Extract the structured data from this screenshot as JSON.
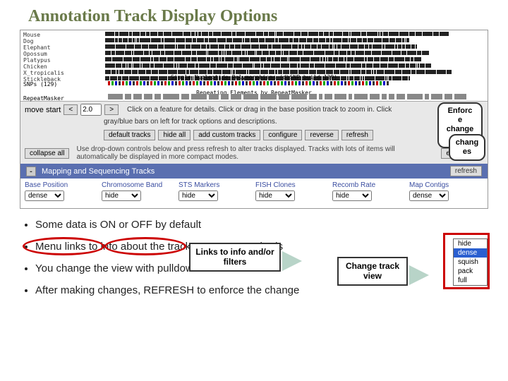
{
  "title": "Annotation Track Display Options",
  "species": [
    "Mouse",
    "Dog",
    "Elephant",
    "Opossum",
    "Platypus",
    "Chicken",
    "X_tropicalis",
    "Stickleback"
  ],
  "snp_label": "Simple Nucleotide Polymorphisms (dbSNP build 129)",
  "snp_row_label": "SNPs (129)",
  "repeat_label": "Repeating Elements by RepeatMasker",
  "repeat_row_label": "RepeatMasker",
  "nav": {
    "move_start": "move start",
    "zoom_val": "2.0",
    "instr1": "Click on a feature for details. Click or drag in the base position track to zoom in. Click",
    "instr2": "gray/blue bars on left for track options and descriptions."
  },
  "default_btns": [
    "default tracks",
    "hide all",
    "add custom tracks",
    "configure",
    "reverse",
    "refresh"
  ],
  "collapse_label": "collapse all",
  "expand_label": "expand all",
  "desc_text": "Use drop-down controls below and press refresh to alter tracks displayed. Tracks with lots of items will automatically be displayed in more compact modes.",
  "section_title": "Mapping and Sequencing Tracks",
  "refresh_label": "refresh",
  "columns": [
    {
      "hdr": "Base Position",
      "val": "dense"
    },
    {
      "hdr": "Chromosome Band",
      "val": "hide"
    },
    {
      "hdr": "STS Markers",
      "val": "hide"
    },
    {
      "hdr": "FISH Clones",
      "val": "hide"
    },
    {
      "hdr": "Recomb Rate",
      "val": "hide"
    },
    {
      "hdr": "Map Contigs",
      "val": "dense"
    }
  ],
  "dropdown_options": [
    "hide",
    "dense",
    "squish",
    "pack",
    "full"
  ],
  "callouts": {
    "links": "Links to info and/or filters",
    "change": "Change track view",
    "enforce": "Enforc\ne\nchange\ns",
    "enforce2": "chang\nes"
  },
  "bullets": [
    "Some data is ON or OFF by default",
    "Menu links to info about the tracks: content, methods",
    "You change the view with pulldown menus",
    "After making changes, REFRESH to enforce the change"
  ]
}
